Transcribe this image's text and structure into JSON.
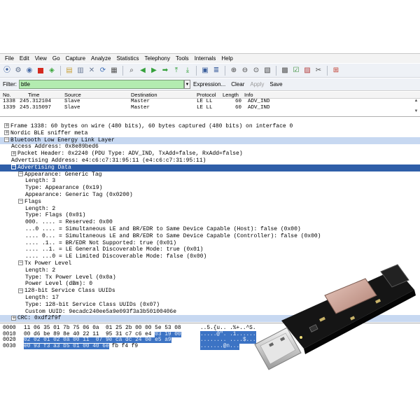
{
  "menu": [
    "File",
    "Edit",
    "View",
    "Go",
    "Capture",
    "Analyze",
    "Statistics",
    "Telephony",
    "Tools",
    "Internals",
    "Help"
  ],
  "toolbar_icons": [
    "interface-list-icon",
    "capture-options-icon",
    "start-capture-icon",
    "stop-capture-icon",
    "restart-capture-icon",
    "open-file-icon",
    "save-file-icon",
    "close-file-icon",
    "reload-icon",
    "print-icon",
    "find-packet-icon",
    "go-back-icon",
    "go-forward-icon",
    "go-to-packet-icon",
    "go-first-icon",
    "go-last-icon",
    "colorize-icon",
    "auto-scroll-icon",
    "zoom-in-icon",
    "zoom-out-icon",
    "normal-size-icon",
    "resize-columns-icon",
    "capture-filters-icon",
    "display-filters-icon",
    "coloring-rules-icon",
    "preferences-icon",
    "help-icon"
  ],
  "filter": {
    "label": "Filter:",
    "value": "btle",
    "links": [
      "Expression...",
      "Clear",
      "Apply",
      "Save"
    ]
  },
  "packet_list": {
    "columns": [
      "No.",
      "Time",
      "Source",
      "Destination",
      "Protocol",
      "Length",
      "Info"
    ],
    "rows": [
      [
        "1338",
        "245.312104",
        "Slave",
        "Master",
        "LE LL",
        "60",
        "ADV_IND"
      ],
      [
        "1339",
        "245.315097",
        "Slave",
        "Master",
        "LE LL",
        "60",
        "ADV_IND"
      ]
    ]
  },
  "tree": [
    {
      "indent": 0,
      "exp": "+",
      "text": "Frame 1338: 60 bytes on wire (480 bits), 60 bytes captured (480 bits) on interface 0",
      "state": ""
    },
    {
      "indent": 0,
      "exp": "+",
      "text": "Nordic BLE sniffer meta",
      "state": ""
    },
    {
      "indent": 0,
      "exp": "-",
      "text": "Bluetooth Low Energy Link Layer",
      "state": "sel"
    },
    {
      "indent": 1,
      "exp": "",
      "text": "Access Address: 0x8e89bed6",
      "state": ""
    },
    {
      "indent": 1,
      "exp": "+",
      "text": "Packet Header: 0x2240 (PDU Type: ADV_IND, TxAdd=false, RxAdd=false)",
      "state": ""
    },
    {
      "indent": 1,
      "exp": "",
      "text": "Advertising Address: e4:c6:c7:31:95:11 (e4:c6:c7:31:95:11)",
      "state": ""
    },
    {
      "indent": 1,
      "exp": "-",
      "text": "Advertising Data",
      "state": "hilite"
    },
    {
      "indent": 2,
      "exp": "-",
      "text": "Appearance: Generic Tag",
      "state": ""
    },
    {
      "indent": 3,
      "exp": "",
      "text": "Length: 3",
      "state": ""
    },
    {
      "indent": 3,
      "exp": "",
      "text": "Type: Appearance (0x19)",
      "state": ""
    },
    {
      "indent": 3,
      "exp": "",
      "text": "Appearance: Generic Tag (0x0200)",
      "state": ""
    },
    {
      "indent": 2,
      "exp": "-",
      "text": "Flags",
      "state": ""
    },
    {
      "indent": 3,
      "exp": "",
      "text": "Length: 2",
      "state": ""
    },
    {
      "indent": 3,
      "exp": "",
      "text": "Type: Flags (0x01)",
      "state": ""
    },
    {
      "indent": 3,
      "exp": "",
      "text": "000. .... = Reserved: 0x00",
      "state": ""
    },
    {
      "indent": 3,
      "exp": "",
      "text": "...0 .... = Simultaneous LE and BR/EDR to Same Device Capable (Host): false (0x00)",
      "state": ""
    },
    {
      "indent": 3,
      "exp": "",
      "text": ".... 0... = Simultaneous LE and BR/EDR to Same Device Capable (Controller): false (0x00)",
      "state": ""
    },
    {
      "indent": 3,
      "exp": "",
      "text": ".... .1.. = BR/EDR Not Supported: true (0x01)",
      "state": ""
    },
    {
      "indent": 3,
      "exp": "",
      "text": ".... ..1. = LE General Discoverable Mode: true (0x01)",
      "state": ""
    },
    {
      "indent": 3,
      "exp": "",
      "text": ".... ...0 = LE Limited Discoverable Mode: false (0x00)",
      "state": ""
    },
    {
      "indent": 2,
      "exp": "-",
      "text": "Tx Power Level",
      "state": ""
    },
    {
      "indent": 3,
      "exp": "",
      "text": "Length: 2",
      "state": ""
    },
    {
      "indent": 3,
      "exp": "",
      "text": "Type: Tx Power Level (0x0a)",
      "state": ""
    },
    {
      "indent": 3,
      "exp": "",
      "text": "Power Level (dBm): 0",
      "state": ""
    },
    {
      "indent": 2,
      "exp": "-",
      "text": "128-bit Service Class UUIDs",
      "state": ""
    },
    {
      "indent": 3,
      "exp": "",
      "text": "Length: 17",
      "state": ""
    },
    {
      "indent": 3,
      "exp": "",
      "text": "Type: 128-bit Service Class UUIDs (0x07)",
      "state": ""
    },
    {
      "indent": 3,
      "exp": "",
      "text": "Custom UUID: 9ecadc240ee5a9e093f3a3b50100406e",
      "state": ""
    },
    {
      "indent": 1,
      "exp": "+",
      "text": "CRC: 0xdf2f9f",
      "state": "sel"
    }
  ],
  "hex": [
    {
      "offset": "0000",
      "bytes_plain": "11 06 35 01 7b 75 06 0a  01 25 2b 00 00 5e 53 08",
      "bytes_sel": "",
      "ascii": "..5.{u.. .%+..^S."
    },
    {
      "offset": "0010",
      "bytes_plain": "00 d6 be 89 8e 40 22 11  95 31 c7 c6 e4 ",
      "bytes_sel": "03 19 00",
      "ascii": ".....@\". .1......"
    },
    {
      "offset": "0020",
      "bytes_plain": "",
      "bytes_sel": "02 02 01 02 0a 00 11  07 9e ca dc 24 0e e5 a9",
      "ascii": "........ ....$..."
    },
    {
      "offset": "0030",
      "bytes_plain": "",
      "bytes_sel": "e0 93 f3 a3 b5 01 00 40 6e",
      "ascii": ".......@n..."
    }
  ],
  "hex_tail": "fb f4 f9"
}
